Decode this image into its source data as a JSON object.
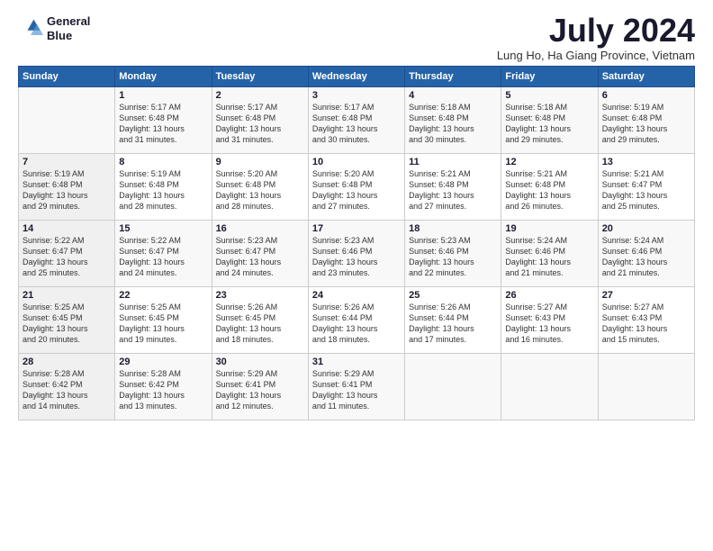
{
  "logo": {
    "line1": "General",
    "line2": "Blue"
  },
  "title": "July 2024",
  "subtitle": "Lung Ho, Ha Giang Province, Vietnam",
  "header_days": [
    "Sunday",
    "Monday",
    "Tuesday",
    "Wednesday",
    "Thursday",
    "Friday",
    "Saturday"
  ],
  "weeks": [
    [
      {
        "day": "",
        "detail": ""
      },
      {
        "day": "1",
        "detail": "Sunrise: 5:17 AM\nSunset: 6:48 PM\nDaylight: 13 hours\nand 31 minutes."
      },
      {
        "day": "2",
        "detail": "Sunrise: 5:17 AM\nSunset: 6:48 PM\nDaylight: 13 hours\nand 31 minutes."
      },
      {
        "day": "3",
        "detail": "Sunrise: 5:17 AM\nSunset: 6:48 PM\nDaylight: 13 hours\nand 30 minutes."
      },
      {
        "day": "4",
        "detail": "Sunrise: 5:18 AM\nSunset: 6:48 PM\nDaylight: 13 hours\nand 30 minutes."
      },
      {
        "day": "5",
        "detail": "Sunrise: 5:18 AM\nSunset: 6:48 PM\nDaylight: 13 hours\nand 29 minutes."
      },
      {
        "day": "6",
        "detail": "Sunrise: 5:19 AM\nSunset: 6:48 PM\nDaylight: 13 hours\nand 29 minutes."
      }
    ],
    [
      {
        "day": "7",
        "detail": "Sunrise: 5:19 AM\nSunset: 6:48 PM\nDaylight: 13 hours\nand 29 minutes."
      },
      {
        "day": "8",
        "detail": "Sunrise: 5:19 AM\nSunset: 6:48 PM\nDaylight: 13 hours\nand 28 minutes."
      },
      {
        "day": "9",
        "detail": "Sunrise: 5:20 AM\nSunset: 6:48 PM\nDaylight: 13 hours\nand 28 minutes."
      },
      {
        "day": "10",
        "detail": "Sunrise: 5:20 AM\nSunset: 6:48 PM\nDaylight: 13 hours\nand 27 minutes."
      },
      {
        "day": "11",
        "detail": "Sunrise: 5:21 AM\nSunset: 6:48 PM\nDaylight: 13 hours\nand 27 minutes."
      },
      {
        "day": "12",
        "detail": "Sunrise: 5:21 AM\nSunset: 6:48 PM\nDaylight: 13 hours\nand 26 minutes."
      },
      {
        "day": "13",
        "detail": "Sunrise: 5:21 AM\nSunset: 6:47 PM\nDaylight: 13 hours\nand 25 minutes."
      }
    ],
    [
      {
        "day": "14",
        "detail": "Sunrise: 5:22 AM\nSunset: 6:47 PM\nDaylight: 13 hours\nand 25 minutes."
      },
      {
        "day": "15",
        "detail": "Sunrise: 5:22 AM\nSunset: 6:47 PM\nDaylight: 13 hours\nand 24 minutes."
      },
      {
        "day": "16",
        "detail": "Sunrise: 5:23 AM\nSunset: 6:47 PM\nDaylight: 13 hours\nand 24 minutes."
      },
      {
        "day": "17",
        "detail": "Sunrise: 5:23 AM\nSunset: 6:46 PM\nDaylight: 13 hours\nand 23 minutes."
      },
      {
        "day": "18",
        "detail": "Sunrise: 5:23 AM\nSunset: 6:46 PM\nDaylight: 13 hours\nand 22 minutes."
      },
      {
        "day": "19",
        "detail": "Sunrise: 5:24 AM\nSunset: 6:46 PM\nDaylight: 13 hours\nand 21 minutes."
      },
      {
        "day": "20",
        "detail": "Sunrise: 5:24 AM\nSunset: 6:46 PM\nDaylight: 13 hours\nand 21 minutes."
      }
    ],
    [
      {
        "day": "21",
        "detail": "Sunrise: 5:25 AM\nSunset: 6:45 PM\nDaylight: 13 hours\nand 20 minutes."
      },
      {
        "day": "22",
        "detail": "Sunrise: 5:25 AM\nSunset: 6:45 PM\nDaylight: 13 hours\nand 19 minutes."
      },
      {
        "day": "23",
        "detail": "Sunrise: 5:26 AM\nSunset: 6:45 PM\nDaylight: 13 hours\nand 18 minutes."
      },
      {
        "day": "24",
        "detail": "Sunrise: 5:26 AM\nSunset: 6:44 PM\nDaylight: 13 hours\nand 18 minutes."
      },
      {
        "day": "25",
        "detail": "Sunrise: 5:26 AM\nSunset: 6:44 PM\nDaylight: 13 hours\nand 17 minutes."
      },
      {
        "day": "26",
        "detail": "Sunrise: 5:27 AM\nSunset: 6:43 PM\nDaylight: 13 hours\nand 16 minutes."
      },
      {
        "day": "27",
        "detail": "Sunrise: 5:27 AM\nSunset: 6:43 PM\nDaylight: 13 hours\nand 15 minutes."
      }
    ],
    [
      {
        "day": "28",
        "detail": "Sunrise: 5:28 AM\nSunset: 6:42 PM\nDaylight: 13 hours\nand 14 minutes."
      },
      {
        "day": "29",
        "detail": "Sunrise: 5:28 AM\nSunset: 6:42 PM\nDaylight: 13 hours\nand 13 minutes."
      },
      {
        "day": "30",
        "detail": "Sunrise: 5:29 AM\nSunset: 6:41 PM\nDaylight: 13 hours\nand 12 minutes."
      },
      {
        "day": "31",
        "detail": "Sunrise: 5:29 AM\nSunset: 6:41 PM\nDaylight: 13 hours\nand 11 minutes."
      },
      {
        "day": "",
        "detail": ""
      },
      {
        "day": "",
        "detail": ""
      },
      {
        "day": "",
        "detail": ""
      }
    ]
  ]
}
